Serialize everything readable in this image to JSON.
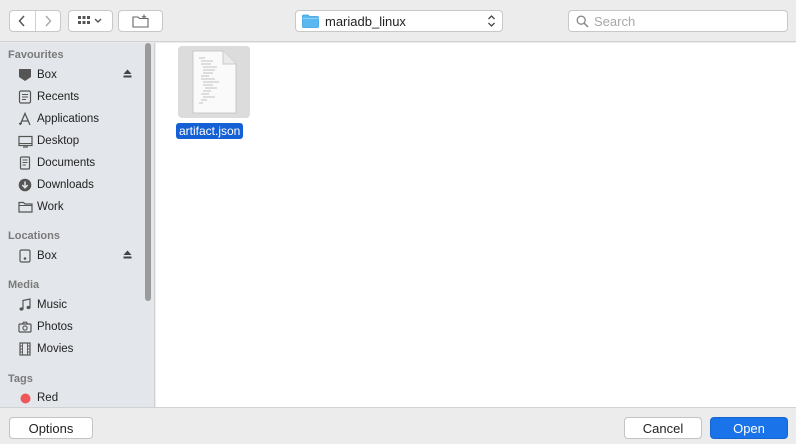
{
  "toolbar": {
    "back_icon": "chevron-left-icon",
    "forward_icon": "chevron-right-icon",
    "view_icon": "icon-grid-icon",
    "new_folder_icon": "new-folder-icon",
    "path": "mariadb_linux",
    "search_placeholder": "Search"
  },
  "sidebar": {
    "sections": [
      {
        "heading": "Favourites",
        "items": [
          "Box",
          "Recents",
          "Applications",
          "Desktop",
          "Documents",
          "Downloads",
          "Work"
        ]
      },
      {
        "heading": "Locations",
        "items": [
          "Box"
        ]
      },
      {
        "heading": "Media",
        "items": [
          "Music",
          "Photos",
          "Movies"
        ]
      },
      {
        "heading": "Tags",
        "items": [
          "Red"
        ]
      }
    ],
    "tag_colors": {
      "Red": "#f0575b"
    }
  },
  "files": [
    {
      "name": "artifact.json",
      "selected": true
    }
  ],
  "footer": {
    "options_label": "Options",
    "cancel_label": "Cancel",
    "open_label": "Open"
  },
  "colors": {
    "accent": "#1a73e8",
    "selection": "#1560d4",
    "sidebar_bg": "#e3e6ea"
  }
}
